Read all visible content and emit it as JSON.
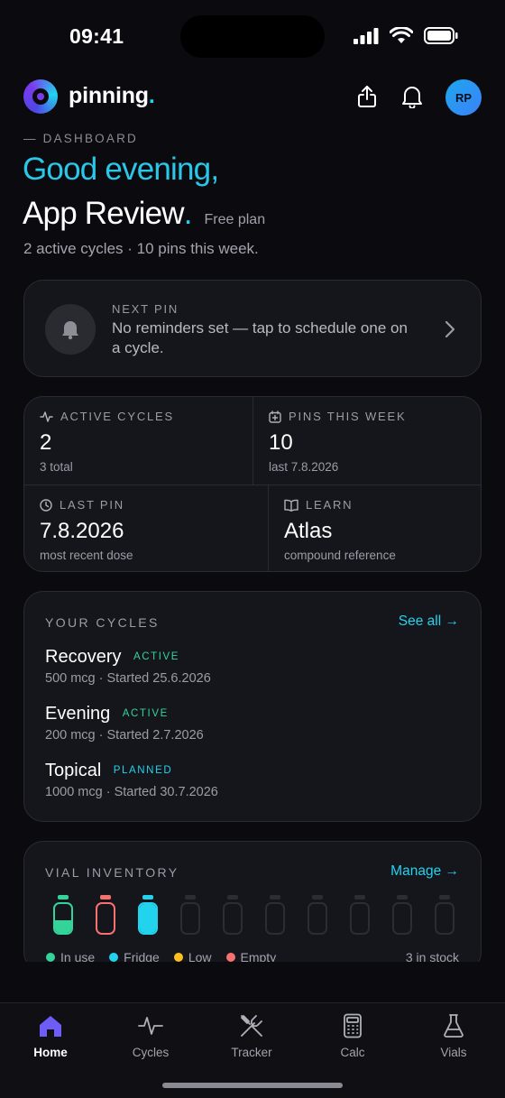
{
  "status_bar": {
    "time": "09:41"
  },
  "header": {
    "brand_name": "pinning",
    "brand_dot": ".",
    "share_icon": "share-icon",
    "bell_icon": "bell-icon",
    "avatar_initials": "RP"
  },
  "greeting": {
    "kicker": "— DASHBOARD",
    "line1": "Good evening,",
    "name": "App Review",
    "name_dot": ".",
    "plan": "Free plan",
    "summary": "2 active cycles · 10 pins this week."
  },
  "next_pin": {
    "label": "NEXT PIN",
    "text": "No reminders set — tap to schedule one on a cycle."
  },
  "stats": [
    {
      "label": "ACTIVE CYCLES",
      "value": "2",
      "sub": "3 total",
      "icon": "pulse-icon"
    },
    {
      "label": "PINS THIS WEEK",
      "value": "10",
      "sub": "last 7.8.2026",
      "icon": "calendar-plus-icon"
    },
    {
      "label": "LAST PIN",
      "value": "7.8.2026",
      "sub": "most recent dose",
      "icon": "clock-icon"
    },
    {
      "label": "LEARN",
      "value": "Atlas",
      "sub": "compound reference",
      "icon": "book-icon"
    }
  ],
  "cycles": {
    "title": "YOUR CYCLES",
    "link": "See all →",
    "items": [
      {
        "name": "Recovery",
        "status": "ACTIVE",
        "meta": "500 mcg · Started 25.6.2026"
      },
      {
        "name": "Evening",
        "status": "ACTIVE",
        "meta": "200 mcg · Started 2.7.2026"
      },
      {
        "name": "Topical",
        "status": "PLANNED",
        "meta": "1000 mcg · Started 30.7.2026"
      }
    ]
  },
  "vials": {
    "title": "VIAL INVENTORY",
    "link": "Manage →",
    "items": [
      {
        "state": "in-use",
        "fill": 0.45
      },
      {
        "state": "empty",
        "fill": 0
      },
      {
        "state": "fridge",
        "fill": 1
      },
      {
        "state": "placeholder",
        "fill": 0
      },
      {
        "state": "placeholder",
        "fill": 0
      },
      {
        "state": "placeholder",
        "fill": 0
      },
      {
        "state": "placeholder",
        "fill": 0
      },
      {
        "state": "placeholder",
        "fill": 0
      },
      {
        "state": "placeholder",
        "fill": 0
      },
      {
        "state": "placeholder",
        "fill": 0
      }
    ],
    "legend": [
      {
        "label": "In use",
        "color": "#34d399"
      },
      {
        "label": "Fridge",
        "color": "#22d3ee"
      },
      {
        "label": "Low",
        "color": "#fbbf24"
      },
      {
        "label": "Empty",
        "color": "#f87171"
      }
    ],
    "stock": "3 in stock"
  },
  "tabs": [
    {
      "label": "Home",
      "icon": "home-icon",
      "active": true
    },
    {
      "label": "Cycles",
      "icon": "pulse-icon",
      "active": false
    },
    {
      "label": "Tracker",
      "icon": "utensils-icon",
      "active": false
    },
    {
      "label": "Calc",
      "icon": "calculator-icon",
      "active": false
    },
    {
      "label": "Vials",
      "icon": "flask-icon",
      "active": false
    }
  ],
  "colors": {
    "accent": "#22d3ee",
    "active": "#34d399",
    "background": "#0b0b0f",
    "card": "#15151c",
    "tab_active": "#6d5cf5"
  }
}
